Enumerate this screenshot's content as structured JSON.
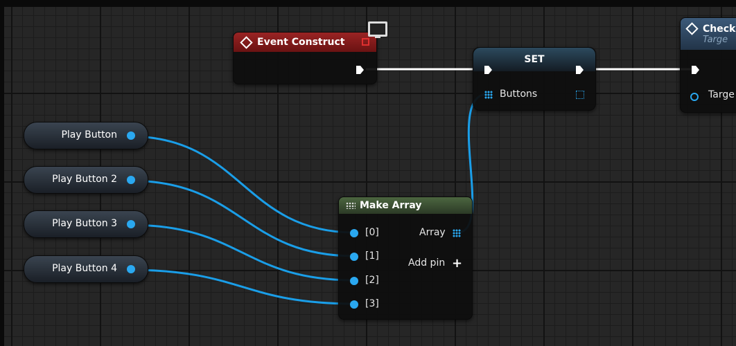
{
  "nodes": {
    "event_construct": {
      "title": "Event Construct"
    },
    "set": {
      "title": "SET",
      "pin_label": "Buttons"
    },
    "check": {
      "title": "Check",
      "subtitle": "Targe",
      "pin_label": "Targe"
    },
    "make_array": {
      "title": "Make Array",
      "inputs": [
        "[0]",
        "[1]",
        "[2]",
        "[3]"
      ],
      "output_label": "Array",
      "add_pin_label": "Add pin"
    }
  },
  "variables": [
    "Play Button",
    "Play Button 2",
    "Play Button 3",
    "Play Button 4"
  ],
  "colors": {
    "object_wire": "#1a9ee8",
    "exec_wire": "#ffffff",
    "event_header": "#8a1c1c",
    "make_array_header": "#3e5634"
  },
  "icons": {
    "event": "diamond-icon",
    "monitor": "monitor-icon",
    "array": "array-grid-icon",
    "add": "plus-icon"
  }
}
